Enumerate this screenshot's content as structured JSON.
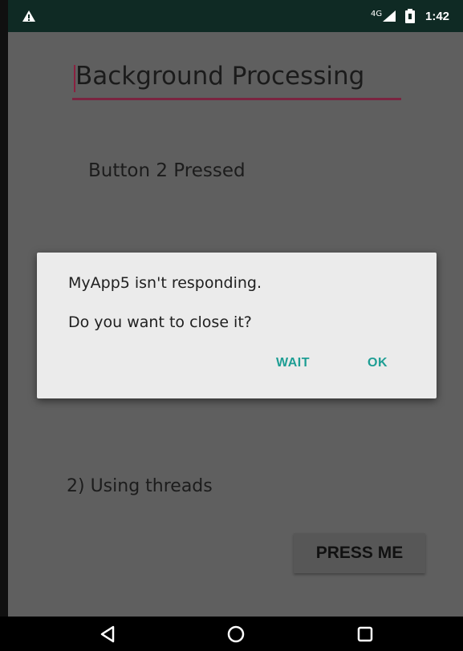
{
  "status_bar": {
    "network_type": "4G",
    "time": "1:42",
    "icons": [
      "warning-icon",
      "signal-icon",
      "battery-icon"
    ]
  },
  "main": {
    "edit_text_value": "Background Processing",
    "status_text": "Button 2 Pressed",
    "section_label": "2) Using threads",
    "press_button_label": "PRESS ME"
  },
  "dialog": {
    "title": "MyApp5 isn't responding.",
    "message": "Do you want to close it?",
    "wait_label": "WAIT",
    "ok_label": "OK"
  },
  "nav_bar": {
    "icons": [
      "back-icon",
      "home-icon",
      "recents-icon"
    ]
  },
  "colors": {
    "status_bar_bg": "#0f2a24",
    "screen_dim_bg": "#5f5f5f",
    "dialog_bg": "#ebebeb",
    "dialog_button_accent": "#1e9e94",
    "edit_text_underline": "#7a2440",
    "nav_bar_bg": "#000000"
  }
}
